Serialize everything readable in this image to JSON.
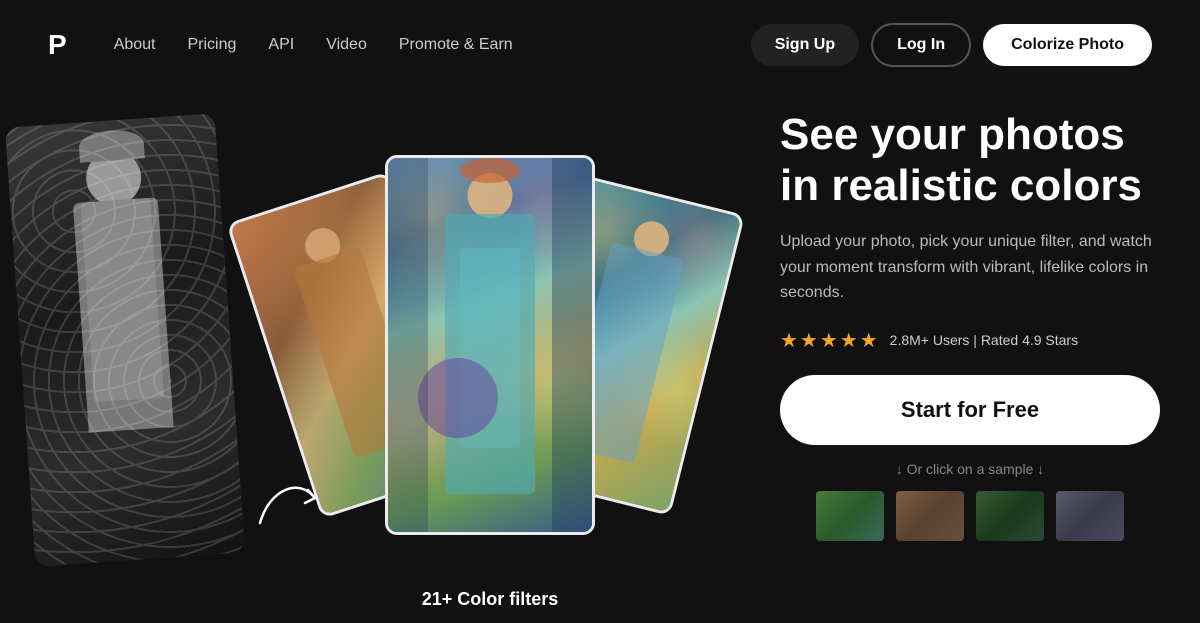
{
  "logo": {
    "letter": "P"
  },
  "nav": {
    "links": [
      {
        "label": "About",
        "id": "about"
      },
      {
        "label": "Pricing",
        "id": "pricing"
      },
      {
        "label": "API",
        "id": "api"
      },
      {
        "label": "Video",
        "id": "video"
      },
      {
        "label": "Promote & Earn",
        "id": "promote"
      }
    ],
    "signup_label": "Sign Up",
    "login_label": "Log In",
    "colorize_label": "Colorize Photo"
  },
  "hero": {
    "headline": "See your photos in realistic colors",
    "subtext": "Upload your photo, pick your unique filter, and watch your moment transform with vibrant, lifelike colors in seconds.",
    "stars": "★★★★★",
    "ratings_text": "2.8M+ Users | Rated 4.9 Stars",
    "cta_label": "Start for Free",
    "sample_hint": "↓ Or click on a sample ↓",
    "caption": "21+ Color filters"
  }
}
